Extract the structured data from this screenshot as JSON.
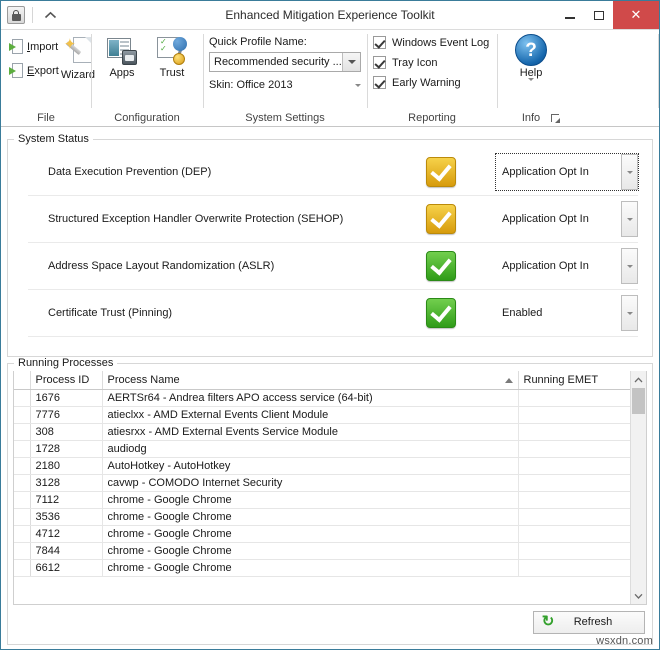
{
  "window": {
    "title": "Enhanced Mitigation Experience Toolkit",
    "app_icon": "lock-shield-icon",
    "ribbon_toggle_icon": "chevron-up-icon",
    "minimize_label": "–",
    "maximize_label": "□",
    "close_label": "✕",
    "border_color": "#3a7c9a",
    "close_color": "#d04a4a"
  },
  "ribbon": {
    "groups": [
      {
        "title": "File",
        "import_label": "Import",
        "import_mnemonic": "I",
        "import_rest": "mport",
        "export_label": "Export",
        "export_mnemonic": "E",
        "export_rest": "xport",
        "wizard_label": "Wizard"
      },
      {
        "title": "Configuration",
        "apps_label": "Apps",
        "trust_label": "Trust"
      },
      {
        "title": "System Settings",
        "quick_profile_label": "Quick Profile Name:",
        "quick_profile_value": "Recommended security ...",
        "skin_label": "Skin: Office 2013"
      },
      {
        "title": "Reporting",
        "checkboxes": [
          {
            "label": "Windows Event Log",
            "checked": true
          },
          {
            "label": "Tray Icon",
            "checked": true
          },
          {
            "label": "Early Warning",
            "checked": true
          }
        ]
      },
      {
        "title": "Info",
        "help_label": "Help",
        "help_icon": "question-mark-icon",
        "dialog_launcher_icon": "dialog-launcher-icon"
      }
    ]
  },
  "system_status": {
    "legend": "System Status",
    "rows": [
      {
        "name": "Data Execution Prevention (DEP)",
        "icon": "check-badge-yellow",
        "icon_color": "#d79b0c",
        "value": "Application Opt In",
        "focused": true
      },
      {
        "name": "Structured Exception Handler Overwrite Protection (SEHOP)",
        "icon": "check-badge-yellow",
        "icon_color": "#d79b0c",
        "value": "Application Opt In",
        "focused": false
      },
      {
        "name": "Address Space Layout Randomization (ASLR)",
        "icon": "check-badge-green",
        "icon_color": "#2f9c18",
        "value": "Application Opt In",
        "focused": false
      },
      {
        "name": "Certificate Trust (Pinning)",
        "icon": "check-badge-green",
        "icon_color": "#2f9c18",
        "value": "Enabled",
        "focused": false
      }
    ]
  },
  "running_processes": {
    "legend": "Running Processes",
    "columns": [
      "",
      "Process ID",
      "Process Name",
      "Running EMET"
    ],
    "sort_column": "Process Name",
    "sort_direction": "ascending",
    "rows": [
      {
        "pid": "1676",
        "name": "AERTSr64 - Andrea filters APO access service (64-bit)",
        "emet": ""
      },
      {
        "pid": "7776",
        "name": "atieclxx - AMD External Events Client Module",
        "emet": ""
      },
      {
        "pid": "308",
        "name": "atiesrxx - AMD External Events Service Module",
        "emet": ""
      },
      {
        "pid": "1728",
        "name": "audiodg",
        "emet": ""
      },
      {
        "pid": "2180",
        "name": "AutoHotkey - AutoHotkey",
        "emet": ""
      },
      {
        "pid": "3128",
        "name": "cavwp - COMODO Internet Security",
        "emet": ""
      },
      {
        "pid": "7112",
        "name": "chrome - Google Chrome",
        "emet": ""
      },
      {
        "pid": "3536",
        "name": "chrome - Google Chrome",
        "emet": ""
      },
      {
        "pid": "4712",
        "name": "chrome - Google Chrome",
        "emet": ""
      },
      {
        "pid": "7844",
        "name": "chrome - Google Chrome",
        "emet": ""
      },
      {
        "pid": "6612",
        "name": "chrome - Google Chrome",
        "emet": ""
      }
    ],
    "refresh_label": "Refresh",
    "refresh_icon": "refresh-icon",
    "scroll_up_icon": "chevron-up-icon",
    "scroll_down_icon": "chevron-down-icon"
  },
  "watermark": "wsxdn.com"
}
